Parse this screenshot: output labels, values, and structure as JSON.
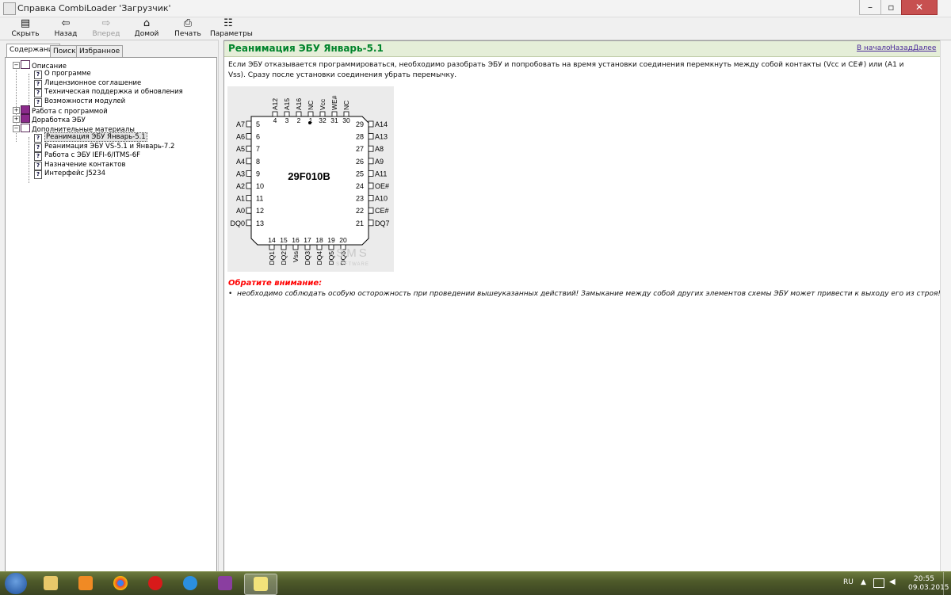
{
  "window": {
    "title": "Справка CombiLoader 'Загрузчик'"
  },
  "toolbar": {
    "hide": "Скрыть",
    "back": "Назад",
    "forward": "Вперед",
    "home": "Домой",
    "print": "Печать",
    "options": "Параметры"
  },
  "tabs": [
    "Содержание",
    "Поиск",
    "Избранное"
  ],
  "tree": {
    "opisanie": "Описание",
    "o_programme": "О программе",
    "license": "Лицензионное соглашение",
    "support": "Техническая поддержка и обновления",
    "modules": "Возможности модулей",
    "rabota": "Работа с программой",
    "dorabotka": "Доработка ЭБУ",
    "extra": "Дополнительные материалы",
    "extra_items": [
      "Реанимация ЭБУ Январь-5.1",
      "Реанимация ЭБУ VS-5.1 и Январь-7.2",
      "Работа с ЭБУ IEFI-6/ITMS-6F",
      "Назначение контактов",
      "Интерфейс J5234"
    ]
  },
  "topic": {
    "title": "Реанимация ЭБУ Январь-5.1",
    "nav": {
      "start": "В начало",
      "back": "Назад",
      "next": "Далее"
    },
    "paragraph": "Если ЭБУ отказывается программироваться, необходимо разобрать ЭБУ и попробовать на время установки соединения перемкнуть между собой контакты (Vcc и CE#) или (A1 и Vss). Сразу после установки соединения убрать перемычку.",
    "note_title": "Обратите внимание:",
    "note_bullet": "необходимо соблюдать особую осторожность при проведении вышеуказанных действий! Замыкание между собой других элементов схемы ЭБУ может привести к выходу его из строя!"
  },
  "chip": {
    "name": "29F010B",
    "top_labels": [
      "A12",
      "A15",
      "A16",
      "NC",
      "Vcc",
      "WE#",
      "NC"
    ],
    "top_nums": [
      "4",
      "3",
      "2",
      "1",
      "32",
      "31",
      "30"
    ],
    "left_labels": [
      "A7",
      "A6",
      "A5",
      "A4",
      "A3",
      "A2",
      "A1",
      "A0",
      "DQ0"
    ],
    "left_nums": [
      "5",
      "6",
      "7",
      "8",
      "9",
      "10",
      "11",
      "12",
      "13"
    ],
    "right_labels": [
      "A14",
      "A13",
      "A8",
      "A9",
      "A11",
      "OE#",
      "A10",
      "CE#",
      "DQ7"
    ],
    "right_nums": [
      "29",
      "28",
      "27",
      "26",
      "25",
      "24",
      "23",
      "22",
      "21"
    ],
    "bottom_labels": [
      "DQ1",
      "DQ2",
      "Vss",
      "DQ3",
      "DQ4",
      "DQ5",
      "DQ6"
    ],
    "bottom_nums": [
      "14",
      "15",
      "16",
      "17",
      "18",
      "19",
      "20"
    ],
    "watermark": "SMS",
    "watermark_sub": "SOFTWARE"
  },
  "system_tray": {
    "lang": "RU",
    "time": "20:55",
    "date": "09.03.2015"
  },
  "colors": {
    "title_green": "#00842b",
    "link_purple": "#4a2a9a",
    "note_red": "#ff0000"
  }
}
